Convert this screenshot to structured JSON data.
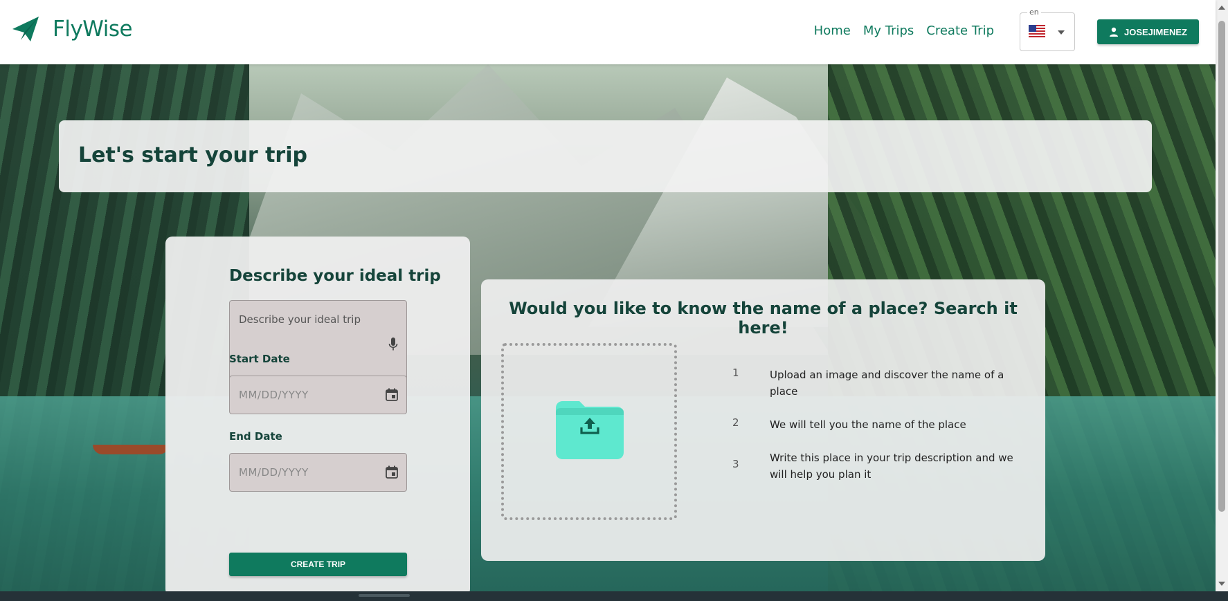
{
  "header": {
    "brand": "FlyWise",
    "nav": [
      "Home",
      "My Trips",
      "Create Trip"
    ],
    "language": {
      "label": "en",
      "selected": "us-flag"
    },
    "user_button": "JOSEJIMENEZ"
  },
  "banner": {
    "title": "Let's start your trip"
  },
  "form": {
    "title": "Describe your ideal trip",
    "description_placeholder": "Describe your ideal trip",
    "start_date_label": "Start Date",
    "start_date_placeholder": "MM/DD/YYYY",
    "end_date_label": "End Date",
    "end_date_placeholder": "MM/DD/YYYY",
    "submit": "CREATE TRIP"
  },
  "search": {
    "title": "Would you like to know the name of a place? Search it here!",
    "steps": [
      {
        "num": "1",
        "text": "Upload an image and discover the name of a place"
      },
      {
        "num": "2",
        "text": "We will tell you the name of the place"
      },
      {
        "num": "3",
        "text": "Write this place in your trip description and we will help you plan it"
      }
    ]
  },
  "colors": {
    "primary": "#0f7a5e",
    "heading": "#15443a",
    "folder": "#5ee8cf"
  }
}
